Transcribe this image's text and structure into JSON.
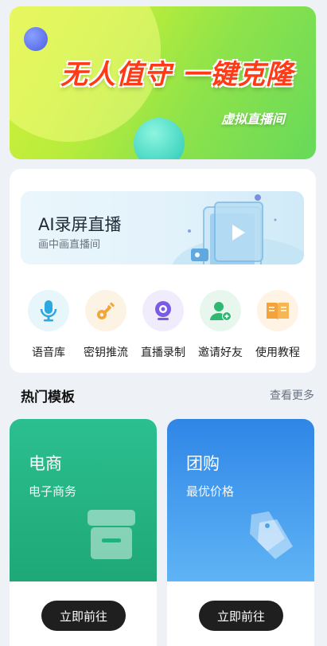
{
  "banner": {
    "title": "无人值守 一键克隆",
    "subtitle": "虚拟直播间"
  },
  "ai_card": {
    "title": "AI录屏直播",
    "subtitle": "画中画直播间"
  },
  "functions": [
    {
      "label": "语音库",
      "icon": "microphone-icon",
      "bg": "#e6f6fb",
      "color": "#2ea8e0"
    },
    {
      "label": "密钥推流",
      "icon": "key-icon",
      "bg": "#fdf3e4",
      "color": "#f0a63a"
    },
    {
      "label": "直播录制",
      "icon": "camera-icon",
      "bg": "#f1ecfc",
      "color": "#7b5be6"
    },
    {
      "label": "邀请好友",
      "icon": "user-add-icon",
      "bg": "#e8f7ee",
      "color": "#2eb872"
    },
    {
      "label": "使用教程",
      "icon": "book-icon",
      "bg": "#fff3e6",
      "color": "#f4a23a"
    }
  ],
  "section": {
    "title": "热门模板",
    "more": "查看更多"
  },
  "templates": [
    {
      "name": "电商",
      "desc": "电子商务",
      "button": "立即前往",
      "icon": "store-icon",
      "color_top": "#2bbf8f",
      "color_bottom": "#1fa877"
    },
    {
      "name": "团购",
      "desc": "最优价格",
      "button": "立即前往",
      "icon": "price-tag-icon",
      "color_top": "#3a8ee8",
      "color_bottom": "#5fb4f5"
    }
  ]
}
